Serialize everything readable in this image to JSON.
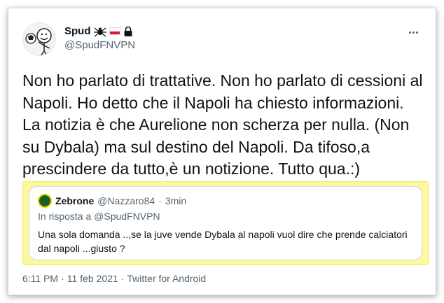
{
  "author": {
    "name": "Spud",
    "handle": "@SpudFNVPN",
    "badges": [
      "spider-icon",
      "poland-flag-icon",
      "lock-icon"
    ]
  },
  "menu": {
    "icon": "more-horizontal-icon"
  },
  "tweet": {
    "text": "Non ho parlato di trattative. Non ho parlato di cessioni al Napoli. Ho detto che il Napoli ha chiesto informazioni. La notizia è che Aurelione non scherza per nulla. (Non su Dybala) ma sul destino del Napoli. Da tifoso,a prescindere da tutto,è un notizione. Tutto qua.:)"
  },
  "quoted": {
    "name": "Zebrone",
    "handle": "@Nazzaro84",
    "separator": "·",
    "time": "3min",
    "reply_prefix": "In risposta a",
    "reply_to": "@SpudFNVPN",
    "text": "Una sola domanda ..,se la juve vende Dybala al napoli vuol dire che prende calciatori dal napoli ...giusto ?"
  },
  "meta": {
    "time": "6:11 PM",
    "separator": "·",
    "date": "11 feb 2021",
    "separator2": "·",
    "source": "Twitter for Android"
  },
  "colors": {
    "highlight": "#fbf8a0",
    "text": "#0f1419",
    "secondary": "#536471",
    "flag_red": "#dc143c"
  }
}
